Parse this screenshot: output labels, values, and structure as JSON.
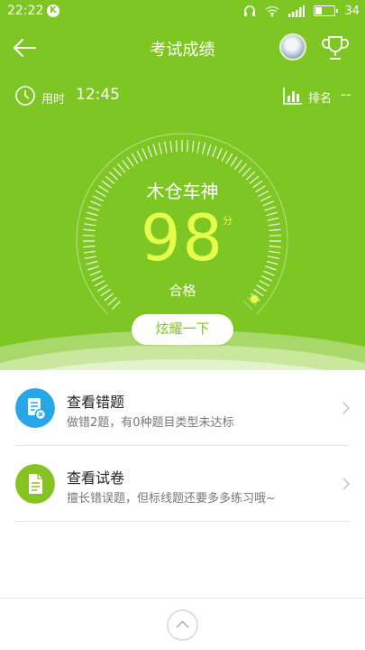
{
  "status_bar": {
    "time": "22:22",
    "app_badge": "K",
    "battery": "34"
  },
  "nav": {
    "title": "考试成绩"
  },
  "info": {
    "time_label": "用时",
    "time_value": "12:45",
    "rank_label": "排名",
    "rank_value": "--"
  },
  "result": {
    "name": "木仓车神",
    "score": "98",
    "score_unit": "分",
    "score_fraction": 0.98,
    "status": "合格",
    "share_label": "炫耀一下"
  },
  "menu": {
    "items": [
      {
        "title": "查看错题",
        "subtitle": "做错2题，有0种题目类型未达标",
        "color": "#27a7e7"
      },
      {
        "title": "查看试卷",
        "subtitle": "擅长错误题，但标线题还要多多练习哦~",
        "color": "#86c221"
      }
    ]
  },
  "colors": {
    "primary_green": "#7dc623",
    "score_yellow": "#e6ff4a",
    "blue": "#27a7e7"
  }
}
